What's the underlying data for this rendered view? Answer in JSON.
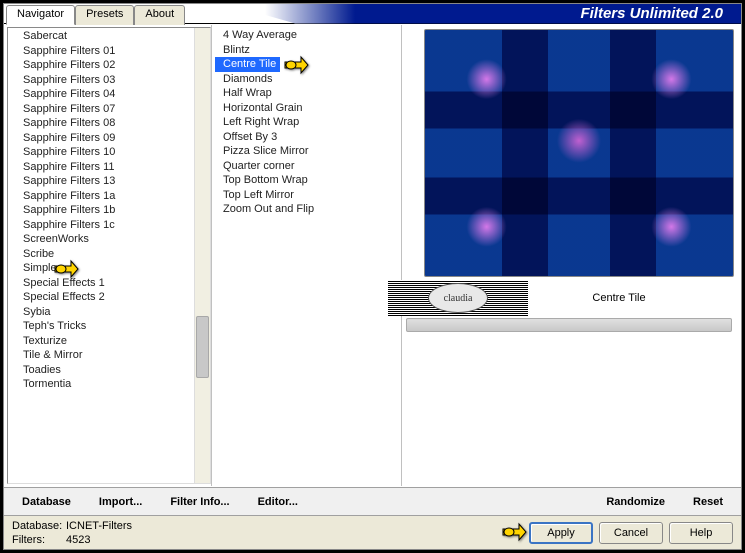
{
  "app": {
    "title": "Filters Unlimited 2.0",
    "tabs": [
      {
        "label": "Navigator",
        "active": true
      },
      {
        "label": "Presets",
        "active": false
      },
      {
        "label": "About",
        "active": false
      }
    ]
  },
  "categories": [
    "Sabercat",
    "Sapphire Filters 01",
    "Sapphire Filters 02",
    "Sapphire Filters 03",
    "Sapphire Filters 04",
    "Sapphire Filters 07",
    "Sapphire Filters 08",
    "Sapphire Filters 09",
    "Sapphire Filters 10",
    "Sapphire Filters 11",
    "Sapphire Filters 13",
    "Sapphire Filters 1a",
    "Sapphire Filters 1b",
    "Sapphire Filters 1c",
    "ScreenWorks",
    "Scribe",
    "Simple",
    "Special Effects 1",
    "Special Effects 2",
    "Sybia",
    "Teph's Tricks",
    "Texturize",
    "Tile & Mirror",
    "Toadies",
    "Tormentia"
  ],
  "selected_category": "Simple",
  "filters": [
    "4 Way Average",
    "Blintz",
    "Centre Tile",
    "Diamonds",
    "Half Wrap",
    "Horizontal Grain",
    "Left Right Wrap",
    "Offset By 3",
    "Pizza Slice Mirror",
    "Quarter corner",
    "Top Bottom Wrap",
    "Top Left Mirror",
    "Zoom Out and Flip"
  ],
  "selected_filter": "Centre Tile",
  "watermark_text": "claudia",
  "toolbar": {
    "database": "Database",
    "import": "Import...",
    "filter_info": "Filter Info...",
    "editor": "Editor...",
    "randomize": "Randomize",
    "reset": "Reset"
  },
  "status": {
    "database_label": "Database:",
    "database_value": "ICNET-Filters",
    "filters_label": "Filters:",
    "filters_value": "4523"
  },
  "buttons": {
    "apply": "Apply",
    "cancel": "Cancel",
    "help": "Help"
  }
}
